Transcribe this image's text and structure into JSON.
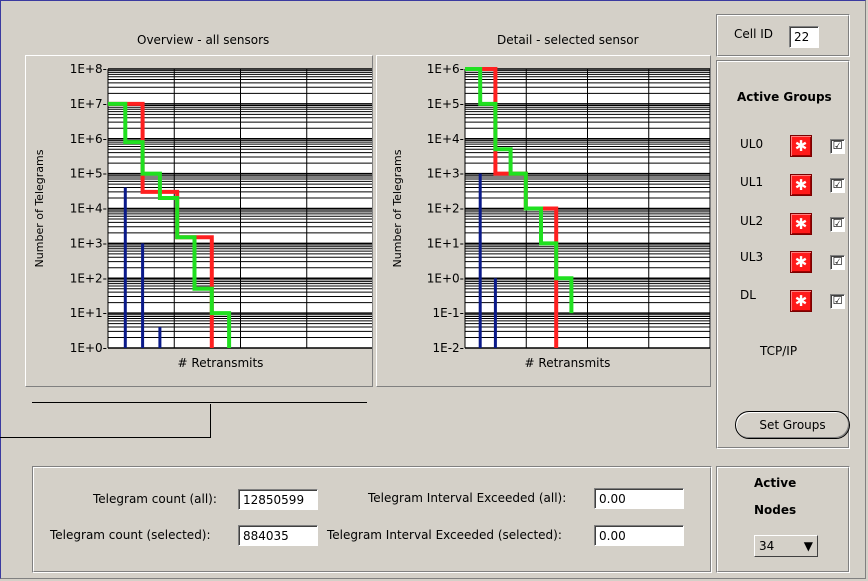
{
  "overview": {
    "title": "Overview - all sensors",
    "ylabel": "Number of Telegrams",
    "xlabel": "# Retransmits",
    "yticks": [
      "1E+8-",
      "1E+7-",
      "1E+6-",
      "1E+5-",
      "1E+4-",
      "1E+3-",
      "1E+2-",
      "1E+1-",
      "1E+0-"
    ]
  },
  "detail": {
    "title": "Detail - selected sensor",
    "ylabel": "Number of Telegrams",
    "xlabel": "# Retransmits",
    "yticks": [
      "1E+6-",
      "1E+5-",
      "1E+4-",
      "1E+3-",
      "1E+2-",
      "1E+1-",
      "1E+0-",
      "1E-1-",
      "1E-2-"
    ]
  },
  "cell": {
    "label": "Cell ID",
    "value": "22"
  },
  "groups": {
    "title": "Active Groups",
    "items": [
      {
        "label": "UL0",
        "checked": "☑"
      },
      {
        "label": "UL1",
        "checked": "☑"
      },
      {
        "label": "UL2",
        "checked": "☑"
      },
      {
        "label": "UL3",
        "checked": "☑"
      },
      {
        "label": "DL",
        "checked": "☑"
      }
    ],
    "protocol": "TCP/IP",
    "set_button": "Set Groups"
  },
  "stats": {
    "count_all_label": "Telegram count (all):",
    "count_all_value": "12850599",
    "count_sel_label": "Telegram count (selected):",
    "count_sel_value": "884035",
    "interval_all_label": "Telegram Interval Exceeded (all):",
    "interval_all_value": "0.00",
    "interval_sel_label": "Telegram Interval Exceeded (selected):",
    "interval_sel_value": "0.00"
  },
  "nodes": {
    "title_line1": "Active",
    "title_line2": "Nodes",
    "value": "34"
  },
  "colors": {
    "red": "#ff2020",
    "green": "#20e020",
    "blue": "#0a1a8a",
    "led": "#ff1a1a"
  },
  "chart_data": [
    {
      "type": "line",
      "title": "Overview - all sensors",
      "ylabel": "Number of Telegrams",
      "xlabel": "# Retransmits",
      "yscale": "log",
      "ylim": [
        1,
        100000000
      ],
      "series": [
        {
          "color": "red",
          "x": [
            0,
            1,
            2,
            3,
            4,
            5,
            6
          ],
          "y": [
            10000000,
            10000000,
            30000,
            30000,
            1500,
            1500,
            1
          ]
        },
        {
          "color": "green",
          "x": [
            0,
            1,
            2,
            3,
            4,
            5,
            6,
            7
          ],
          "y": [
            10000000,
            800000,
            100000,
            20000,
            1500,
            50,
            10,
            1
          ]
        },
        {
          "color": "blue",
          "x": [
            1,
            2,
            3
          ],
          "y": [
            40000,
            1000,
            4
          ]
        }
      ]
    },
    {
      "type": "line",
      "title": "Detail - selected sensor",
      "ylabel": "Number of Telegrams",
      "xlabel": "# Retransmits",
      "yscale": "log",
      "ylim": [
        0.01,
        1000000
      ],
      "series": [
        {
          "color": "red",
          "x": [
            0,
            1,
            2,
            3,
            4,
            5,
            6
          ],
          "y": [
            1000000,
            1000000,
            1000,
            1000,
            100,
            100,
            0.01
          ]
        },
        {
          "color": "green",
          "x": [
            0,
            1,
            2,
            3,
            4,
            5,
            6,
            7
          ],
          "y": [
            1000000,
            100000,
            5000,
            1000,
            100,
            10,
            1,
            0.1
          ]
        },
        {
          "color": "blue",
          "x": [
            1,
            2
          ],
          "y": [
            1000,
            1
          ]
        }
      ]
    }
  ]
}
